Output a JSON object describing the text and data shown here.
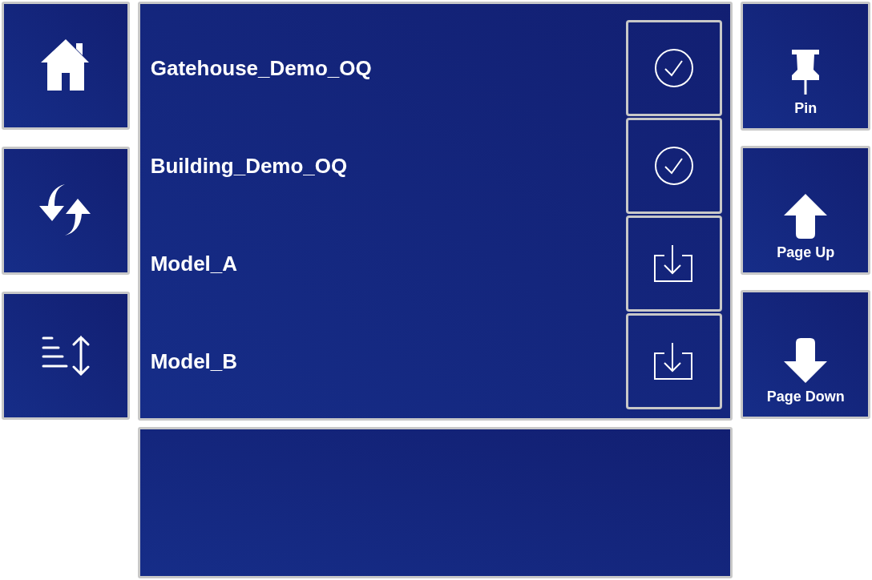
{
  "left_buttons": [
    {
      "kind": "home"
    },
    {
      "kind": "sync"
    },
    {
      "kind": "sort"
    }
  ],
  "projects": [
    {
      "name": "Gatehouse_Demo_OQ",
      "downloaded": true
    },
    {
      "name": "Building_Demo_OQ",
      "downloaded": true
    },
    {
      "name": "Model_A",
      "downloaded": false
    },
    {
      "name": "Model_B",
      "downloaded": false
    }
  ],
  "right_buttons": [
    {
      "kind": "pin",
      "label": "Pin"
    },
    {
      "kind": "up",
      "label": "Page Up"
    },
    {
      "kind": "down",
      "label": "Page Down"
    }
  ]
}
